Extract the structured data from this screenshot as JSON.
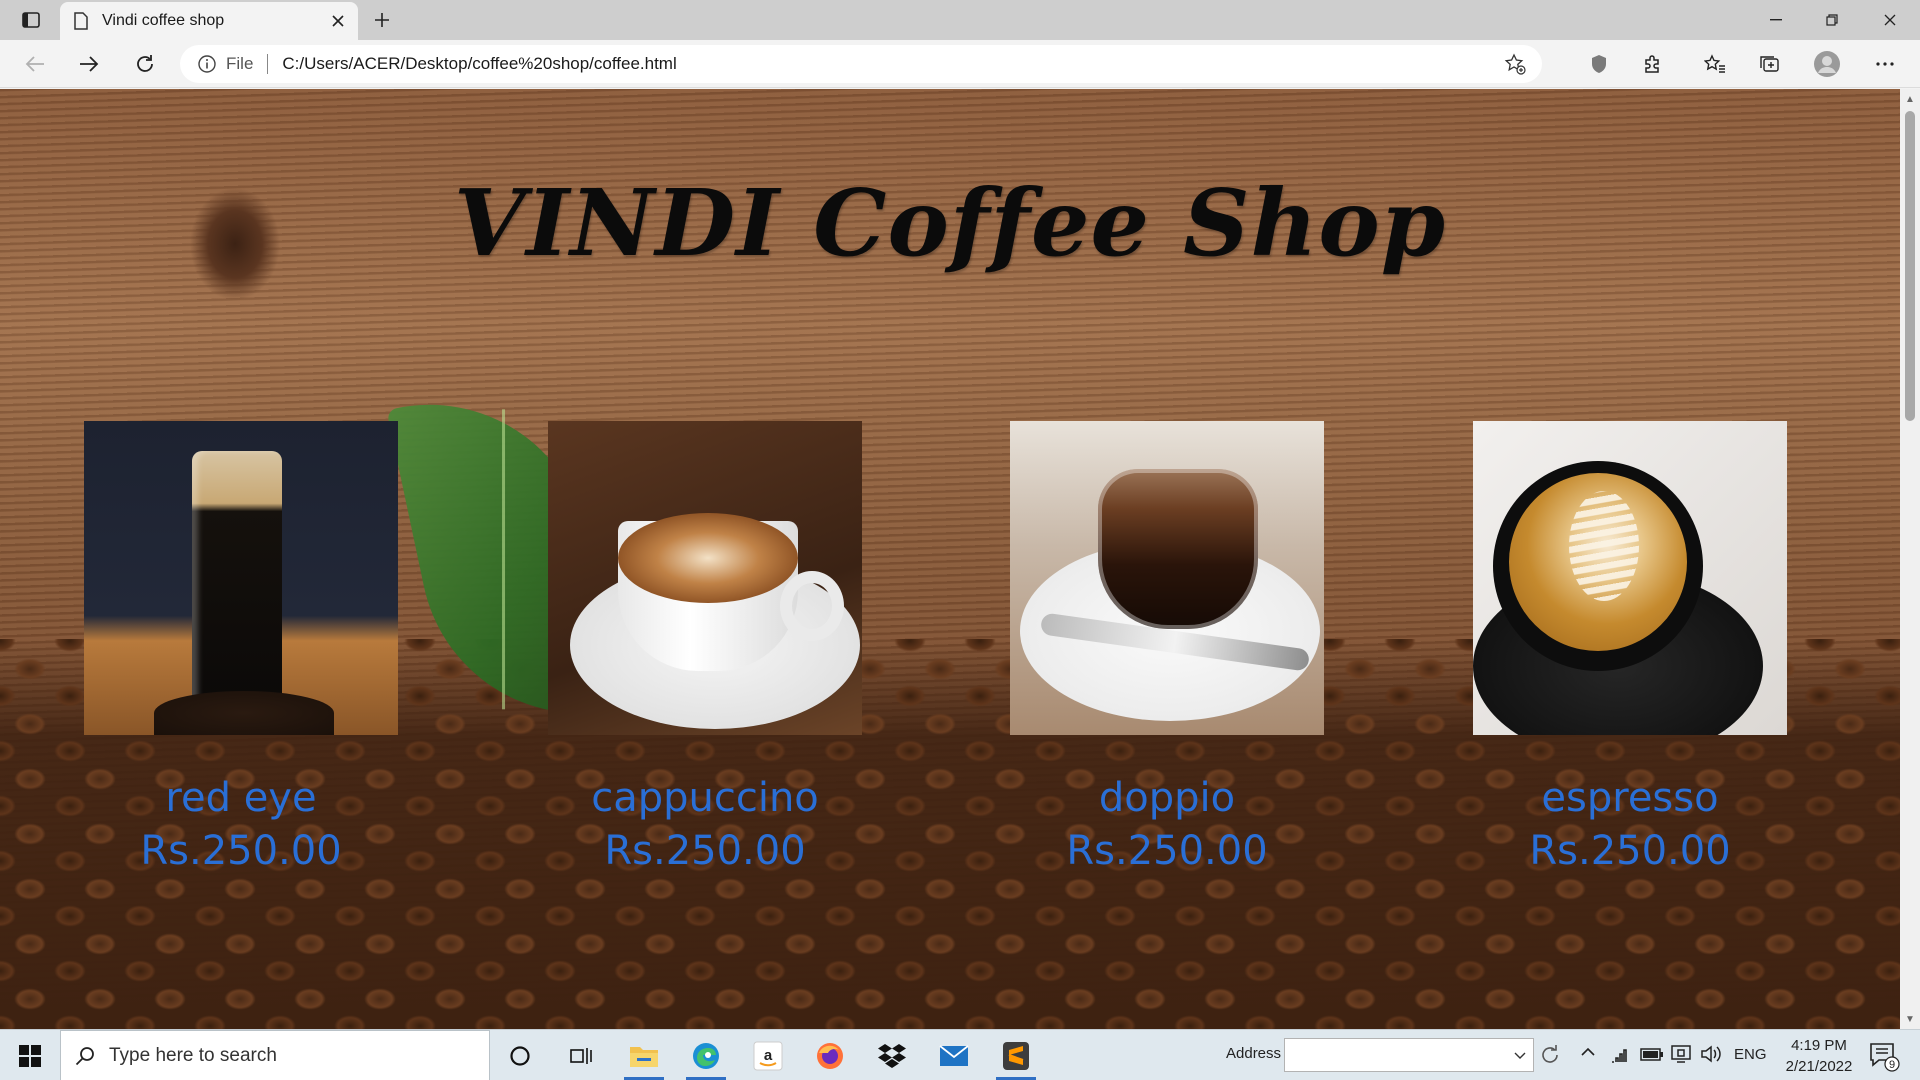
{
  "browser": {
    "tab_title": "Vindi coffee shop",
    "file_label": "File",
    "url": "C:/Users/ACER/Desktop/coffee%20shop/coffee.html"
  },
  "page": {
    "heading": "VINDI Coffee Shop",
    "products": [
      {
        "name": "red eye",
        "price": "Rs.250.00"
      },
      {
        "name": "cappuccino",
        "price": "Rs.250.00"
      },
      {
        "name": "doppio",
        "price": "Rs.250.00"
      },
      {
        "name": "espresso",
        "price": "Rs.250.00"
      }
    ],
    "text_color": "#2a6fd6"
  },
  "taskbar": {
    "search_placeholder": "Type here to search",
    "address_label": "Address",
    "address_value": "",
    "language": "ENG",
    "time": "4:19 PM",
    "date": "2/21/2022",
    "notification_count": "9"
  }
}
